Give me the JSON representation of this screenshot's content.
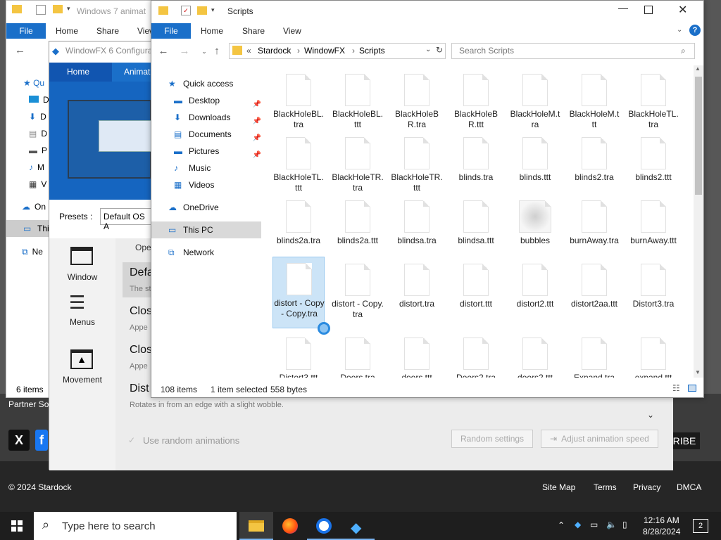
{
  "website": {
    "partner_text": "Partner So",
    "subscribe_text": "RIBE",
    "copyright": "© 2024 Stardock",
    "footer_links": [
      "Site Map",
      "Terms",
      "Privacy",
      "DMCA"
    ]
  },
  "bg_explorer": {
    "title": "Windows 7 animat",
    "tabs": [
      "File",
      "Home",
      "Share",
      "View"
    ],
    "status": "6 items",
    "nav_items": [
      "Qu",
      "D",
      "D",
      "D",
      "P",
      "M",
      "V",
      "On",
      "This",
      "Ne"
    ]
  },
  "windowfx": {
    "title": "WindowFX 6 Configura",
    "tabs": [
      "Home",
      "Animat"
    ],
    "presets_label": "Presets :",
    "presets_value": "Default OS A",
    "sidebar": [
      {
        "label": "Window",
        "icon": "window-icon"
      },
      {
        "label": "Menus",
        "icon": "menus-icon"
      },
      {
        "label": "Movement",
        "icon": "movement-icon"
      }
    ],
    "open_label": "Ope",
    "options": [
      {
        "title": "Defa",
        "sub": "The st"
      },
      {
        "title": "Clos",
        "sub": "Appe"
      },
      {
        "title": "Clos",
        "sub": "Appe"
      },
      {
        "title": "Dist",
        "sub": "Rotates in from an edge with a slight wobble."
      }
    ],
    "random_label": "Use random animations",
    "random_settings": "Random settings",
    "adjust_speed": "Adjust animation speed"
  },
  "explorer": {
    "title": "Scripts",
    "tabs": [
      "File",
      "Home",
      "Share",
      "View"
    ],
    "breadcrumb": [
      "«",
      "Stardock",
      "WindowFX",
      "Scripts"
    ],
    "search_placeholder": "Search Scripts",
    "nav": [
      {
        "label": "Quick access",
        "icon": "star-icon",
        "indent": 0
      },
      {
        "label": "Desktop",
        "icon": "desktop-icon",
        "indent": 1,
        "pinned": true
      },
      {
        "label": "Downloads",
        "icon": "download-icon",
        "indent": 1,
        "pinned": true
      },
      {
        "label": "Documents",
        "icon": "documents-icon",
        "indent": 1,
        "pinned": true
      },
      {
        "label": "Pictures",
        "icon": "pictures-icon",
        "indent": 1,
        "pinned": true
      },
      {
        "label": "Music",
        "icon": "music-icon",
        "indent": 1
      },
      {
        "label": "Videos",
        "icon": "videos-icon",
        "indent": 1
      },
      {
        "label": "OneDrive",
        "icon": "cloud-icon",
        "indent": 0
      },
      {
        "label": "This PC",
        "icon": "pc-icon",
        "indent": 0,
        "selected": true
      },
      {
        "label": "Network",
        "icon": "network-icon",
        "indent": 0
      }
    ],
    "files": [
      "BlackHoleBL.tra",
      "BlackHoleBL.ttt",
      "BlackHoleBR.tra",
      "BlackHoleBR.ttt",
      "BlackHoleM.tra",
      "BlackHoleM.ttt",
      "BlackHoleTL.tra",
      "BlackHoleTL.ttt",
      "BlackHoleTR.tra",
      "BlackHoleTR.ttt",
      "blinds.tra",
      "blinds.ttt",
      "blinds2.tra",
      "blinds2.ttt",
      "blinds2a.tra",
      "blinds2a.ttt",
      "blindsa.tra",
      "blindsa.ttt",
      "bubbles",
      "burnAway.tra",
      "burnAway.ttt",
      "distort - Copy - Copy.tra",
      "distort - Copy.tra",
      "distort.tra",
      "distort.ttt",
      "distort2.ttt",
      "distort2aa.ttt",
      "Distort3.tra",
      "Distort3.ttt",
      "Doors.tra",
      "doors.ttt",
      "Doors2.tra",
      "doors2.ttt",
      "Expand.tra",
      "expand.ttt"
    ],
    "selected_file": "distort - Copy - Copy.tra",
    "status_items": "108 items",
    "status_selected": "1 item selected",
    "status_size": "558 bytes"
  },
  "taskbar": {
    "search_placeholder": "Type here to search",
    "time": "12:16 AM",
    "date": "8/28/2024",
    "notification_count": "2"
  }
}
